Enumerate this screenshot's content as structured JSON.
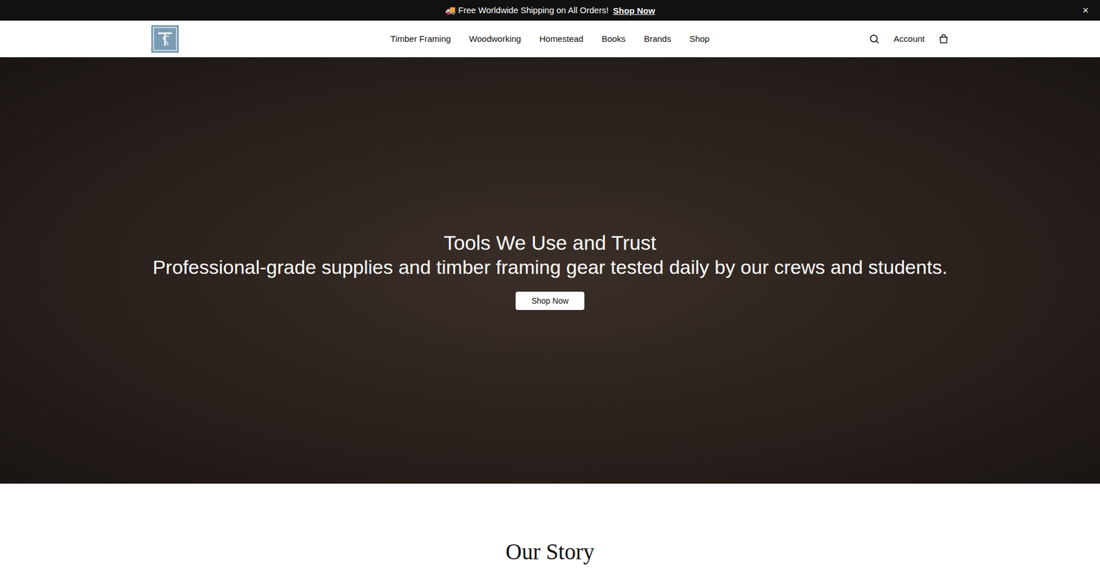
{
  "announcement": {
    "text": "🚚 Free Worldwide Shipping on All Orders!",
    "link": "Shop Now",
    "close": "×"
  },
  "nav": {
    "items": [
      "Timber Framing",
      "Woodworking",
      "Homestead",
      "Books",
      "Brands",
      "Shop"
    ]
  },
  "actions": {
    "account": "Account"
  },
  "hero": {
    "title": "Tools We Use and Trust",
    "subtitle": "Professional-grade supplies and timber framing gear tested daily by our crews and students.",
    "button": "Shop Now"
  },
  "story": {
    "title": "Our Story"
  }
}
